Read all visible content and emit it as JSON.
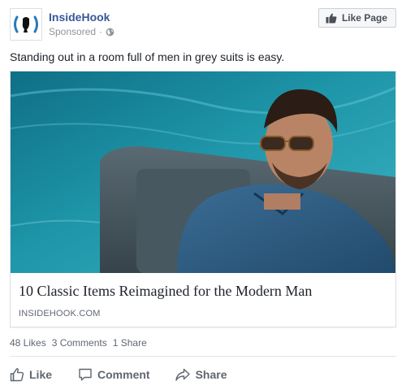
{
  "header": {
    "page_name": "InsideHook",
    "sponsored": "Sponsored",
    "separator": "·",
    "like_page_label": "Like Page",
    "avatar_icon": "insidehook-logo-icon",
    "globe_icon": "globe-icon"
  },
  "caption": "Standing out in a room full of men in grey suits is easy.",
  "card": {
    "title": "10 Classic Items Reimagined for the Modern Man",
    "domain": "INSIDEHOOK.COM"
  },
  "stats": {
    "likes": "48 Likes",
    "comments": "3 Comments",
    "shares": "1 Share"
  },
  "actions": {
    "like": "Like",
    "comment": "Comment",
    "share": "Share"
  },
  "colors": {
    "brand_link": "#365899",
    "muted": "#606770",
    "pool": "#1e8fa0",
    "shirt": "#2f5b80"
  }
}
